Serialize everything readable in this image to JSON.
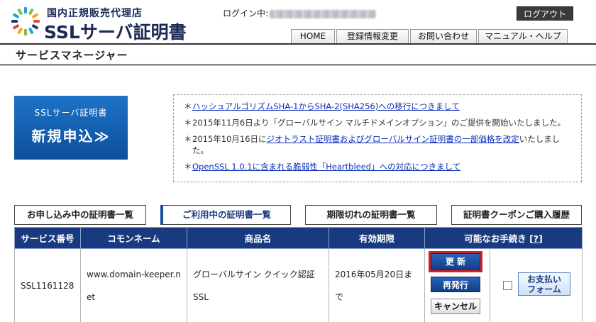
{
  "brand": {
    "sub": "国内正規販売代理店",
    "main": "SSLサーバ証明書",
    "logo_icon": "logo-sunburst-icon"
  },
  "header": {
    "login_label": "ログイン中:",
    "logout_label": "ログアウト",
    "nav": [
      "HOME",
      "登録情報変更",
      "お問い合わせ",
      "マニュアル・ヘルプ"
    ]
  },
  "page_title": "サービスマネージャー",
  "apply_banner": {
    "sub": "SSLサーバ証明書",
    "main": "新規申込≫"
  },
  "notices": [
    {
      "bullet": "＊",
      "link": "ハッシュアルゴリズムSHA-1からSHA-2(SHA256)への移行につきまして",
      "text": ""
    },
    {
      "bullet": "＊",
      "link": "",
      "text": "2015年11月6日より「グローバルサイン マルチドメインオプション」のご提供を開始いたしました。"
    },
    {
      "bullet": "＊",
      "pre": "2015年10月16日に",
      "link": "ジオトラスト証明書およびグローバルサイン証明書の一部価格を改定",
      "text": "いたしました。"
    },
    {
      "bullet": "＊",
      "link": "OpenSSL 1.0.1に含まれる脆弱性「Heartbleed」への対応につきまして",
      "text": ""
    }
  ],
  "tabs": [
    "お申し込み中の証明書一覧",
    "ご利用中の証明書一覧",
    "期限切れの証明書一覧",
    "証明書クーポンご購入履歴"
  ],
  "table": {
    "headers": [
      "サービス番号",
      "コモンネーム",
      "商品名",
      "有効期限",
      "可能なお手続き"
    ],
    "help_link": "?",
    "rows": [
      {
        "service_no": "SSL1161128",
        "common_name": "www.domain-keeper.net",
        "product": "グローバルサイン クイック認証SSL",
        "expiry": "2016年05月20日まで"
      }
    ],
    "actions": {
      "update": "更 新",
      "reissue": "再発行",
      "cancel": "キャンセル",
      "pay": "お支払い\nフォーム"
    }
  },
  "colors": {
    "header_blue": "#1a3a80",
    "banner_blue": "#1d73c6",
    "highlight_red": "#d0202a",
    "link_blue": "#0a2db8"
  }
}
